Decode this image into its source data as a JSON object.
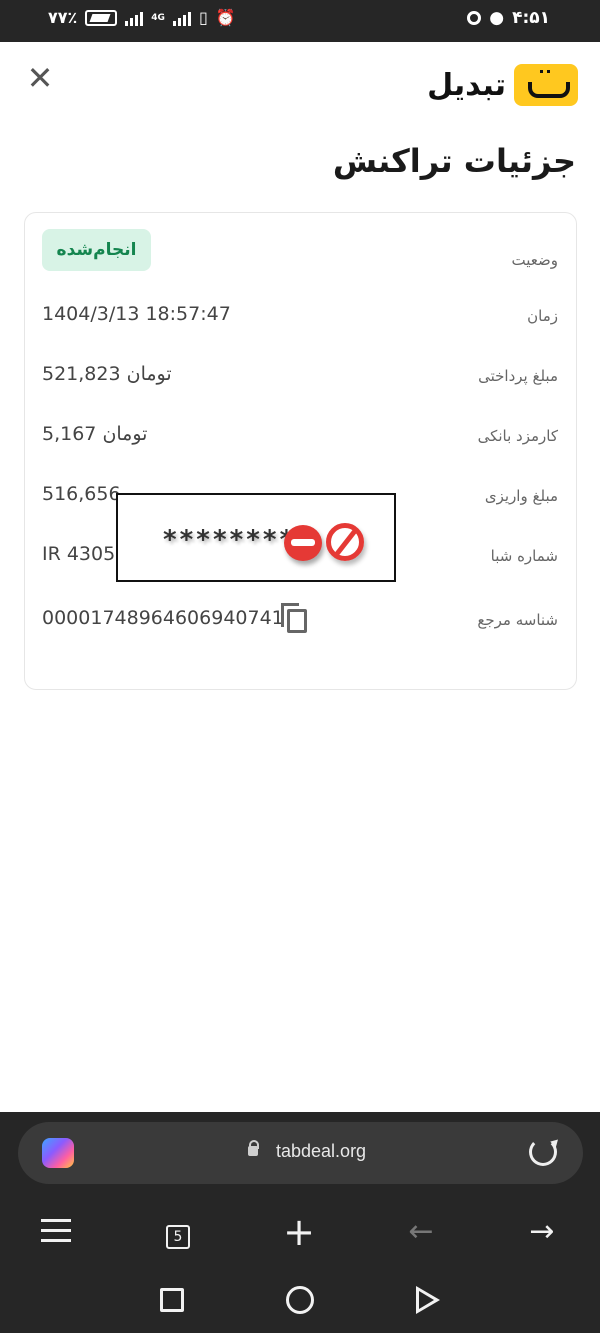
{
  "status_bar": {
    "battery_text": "۷۷٪",
    "network_label": "4G",
    "clock": "۴:۵۱"
  },
  "header": {
    "brand_name": "تبدیل",
    "close_icon": "close-icon"
  },
  "page": {
    "title": "جزئیات تراکنش"
  },
  "details": {
    "status": {
      "label": "وضعیت",
      "value": "انجام‌شده"
    },
    "time": {
      "label": "زمان",
      "value": "1404/3/13 18:57:47"
    },
    "paid_amount": {
      "label": "مبلغ پرداختی",
      "value": "521,823 تومان"
    },
    "bank_fee": {
      "label": "کارمزد بانکی",
      "value": "5,167 تومان"
    },
    "deposit_amount": {
      "label": "مبلغ واریزی",
      "value": "516,656"
    },
    "sheba": {
      "label": "شماره شبا",
      "value": "IR 4305"
    },
    "reference": {
      "label": "شناسه مرجع",
      "value": "0000174896460694074​1"
    }
  },
  "redaction": {
    "stars": "********"
  },
  "browser": {
    "url": "tabdeal.org",
    "tab_count": "5"
  },
  "colors": {
    "brand_yellow": "#ffc81f",
    "success_green": "#14854f",
    "success_bg": "#d8f3e6",
    "dark_chrome": "#262626"
  }
}
